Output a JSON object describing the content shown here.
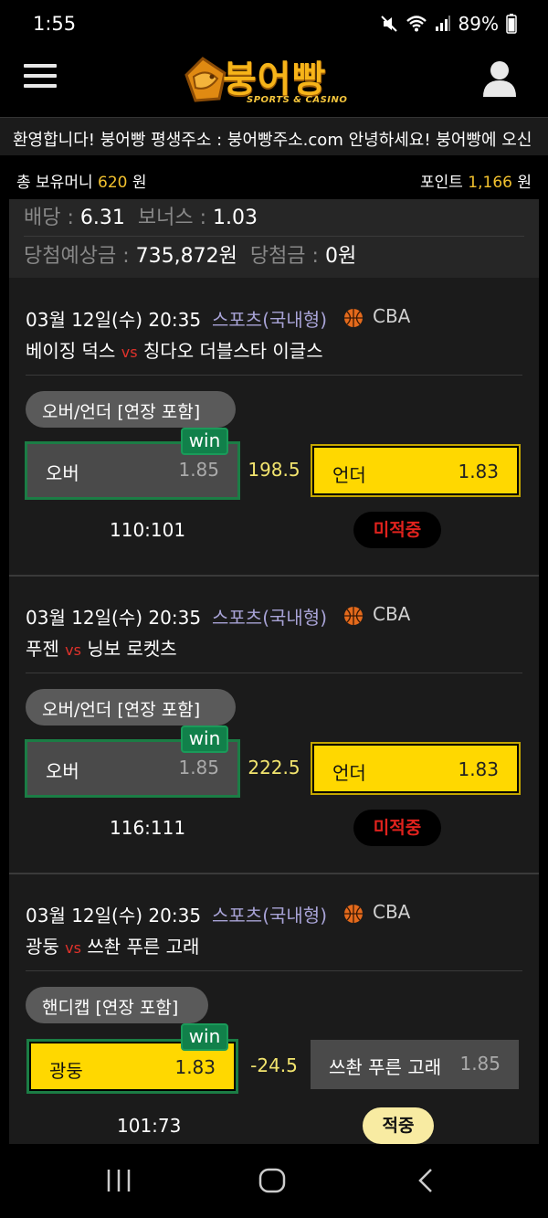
{
  "status_bar": {
    "time": "1:55",
    "battery": "89%"
  },
  "header": {
    "logo_text": "붕어빵",
    "logo_sub": "SPORTS & CASINO"
  },
  "ticker": {
    "text": "환영합니다! 붕어빵 평생주소 : 붕어빵주소.com   안녕하세요! 붕어빵에 오신"
  },
  "balance": {
    "money_label": "총 보유머니",
    "money_value": "620",
    "money_unit": "원",
    "point_label": "포인트",
    "point_value": "1,166",
    "point_unit": "원"
  },
  "summary": {
    "odds_label": "배당 : ",
    "odds_value": "6.31",
    "bonus_label": "보너스 : ",
    "bonus_value": "1.03",
    "expected_label": "당첨예상금 : ",
    "expected_value": "735,872원",
    "win_label": "당첨금 : ",
    "win_value": "0원"
  },
  "bets": [
    {
      "date": "03월 12일(수) 20:35",
      "category": "스포츠(국내형)",
      "league": "CBA",
      "home": "베이징 덕스",
      "vs": "vs",
      "away": "칭다오 더블스타 이글스",
      "market": "오버/언더 [연장 포함]",
      "win_tag": "win",
      "left_label": "오버",
      "left_odds": "1.85",
      "line": "198.5",
      "right_label": "언더",
      "right_odds": "1.83",
      "score": "110:101",
      "status": "미적중"
    },
    {
      "date": "03월 12일(수) 20:35",
      "category": "스포츠(국내형)",
      "league": "CBA",
      "home": "푸젠",
      "vs": "vs",
      "away": "닝보 로켓츠",
      "market": "오버/언더 [연장 포함]",
      "win_tag": "win",
      "left_label": "오버",
      "left_odds": "1.85",
      "line": "222.5",
      "right_label": "언더",
      "right_odds": "1.83",
      "score": "116:111",
      "status": "미적중"
    },
    {
      "date": "03월 12일(수) 20:35",
      "category": "스포츠(국내형)",
      "league": "CBA",
      "home": "광둥",
      "vs": "vs",
      "away": "쓰촨 푸른 고래",
      "market": "핸디캡 [연장 포함]",
      "win_tag": "win",
      "left_label": "광둥",
      "left_odds": "1.83",
      "line": "-24.5",
      "right_label": "쓰촨 푸른 고래",
      "right_odds": "1.85",
      "score": "101:73",
      "status": "적중"
    }
  ],
  "colors": {
    "accent_yellow": "#ffd800",
    "win_green": "#11804a",
    "lose_red": "#e0221d",
    "background": "#1b1b1b"
  }
}
